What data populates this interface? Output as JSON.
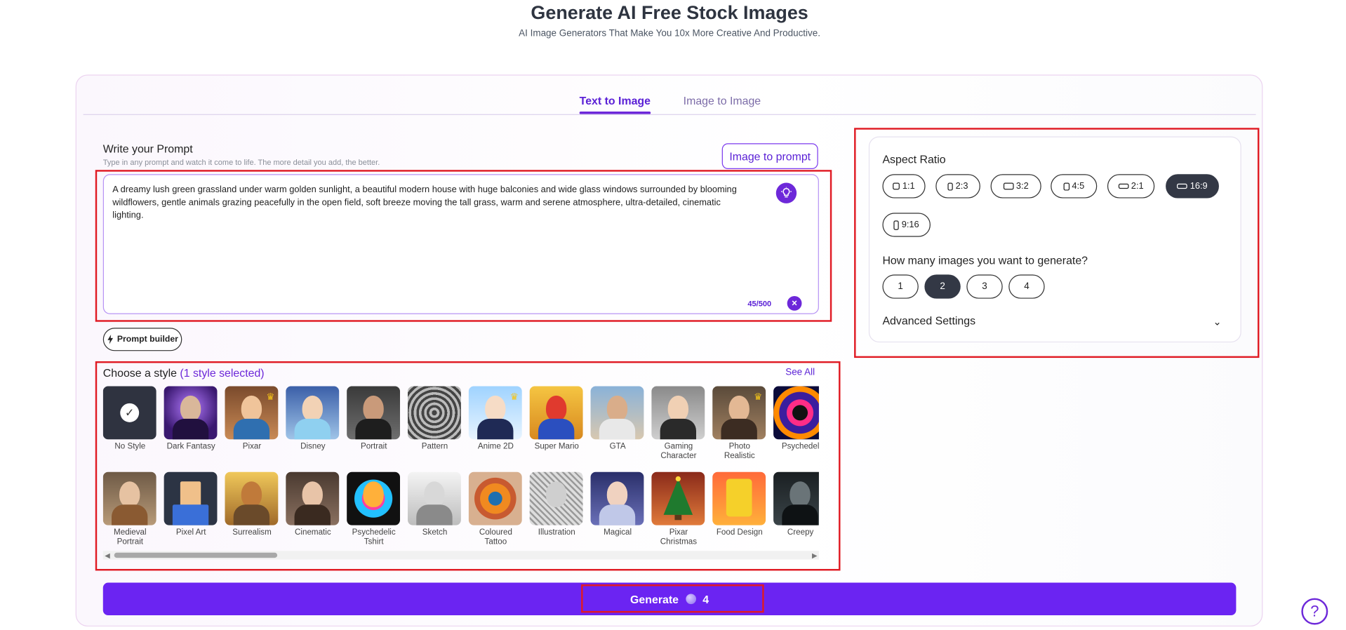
{
  "header": {
    "title": "Generate AI Free Stock Images",
    "subtitle": "AI Image Generators That Make You 10x More Creative And Productive."
  },
  "tabs": {
    "active": "Text to Image",
    "inactive": "Image to Image"
  },
  "prompt": {
    "title": "Write your Prompt",
    "hint": "Type in any prompt and watch it come to life. The more detail you add, the better.",
    "image_to_prompt_label": "Image to prompt",
    "text": "A dreamy lush green grassland under warm golden sunlight, a beautiful modern house with huge balconies and wide glass windows surrounded by blooming wildflowers, gentle animals grazing peacefully in the open field, soft breeze moving the tall grass, warm and serene atmosphere, ultra-detailed, cinematic lighting.",
    "char_count": "45/500",
    "prompt_builder_label": "Prompt builder"
  },
  "styles": {
    "header_label": "Choose a style",
    "selected_count": "(1 style selected)",
    "see_all_label": "See All",
    "row1": [
      {
        "label": "No Style",
        "selected": true
      },
      {
        "label": "Dark Fantasy"
      },
      {
        "label": "Pixar",
        "premium": true
      },
      {
        "label": "Disney"
      },
      {
        "label": "Portrait"
      },
      {
        "label": "Pattern"
      },
      {
        "label": "Anime 2D",
        "premium": true
      },
      {
        "label": "Super Mario"
      },
      {
        "label": "GTA"
      },
      {
        "label": "Gaming Character"
      },
      {
        "label": "Photo Realistic",
        "premium": true
      },
      {
        "label": "Psychedel"
      }
    ],
    "row2": [
      {
        "label": "Medieval Portrait"
      },
      {
        "label": "Pixel Art"
      },
      {
        "label": "Surrealism"
      },
      {
        "label": "Cinematic"
      },
      {
        "label": "Psychedelic Tshirt"
      },
      {
        "label": "Sketch"
      },
      {
        "label": "Coloured Tattoo"
      },
      {
        "label": "Illustration"
      },
      {
        "label": "Magical"
      },
      {
        "label": "Pixar Christmas"
      },
      {
        "label": "Food Design"
      },
      {
        "label": "Creepy"
      }
    ]
  },
  "generate": {
    "label": "Generate",
    "credits": "4"
  },
  "settings": {
    "aspect_ratio_title": "Aspect Ratio",
    "ratios": [
      "1:1",
      "2:3",
      "3:2",
      "4:5",
      "2:1",
      "16:9",
      "9:16"
    ],
    "selected_ratio": "16:9",
    "count_title": "How many images you want to generate?",
    "counts": [
      "1",
      "2",
      "3",
      "4"
    ],
    "selected_count": "2",
    "advanced_label": "Advanced Settings"
  },
  "colors": {
    "accent": "#6d28d9",
    "generate_bg": "#6b24f2",
    "selected_pill": "#333845",
    "highlight_box": "#e01b24"
  },
  "icons": {
    "help": "question-mark-icon"
  }
}
